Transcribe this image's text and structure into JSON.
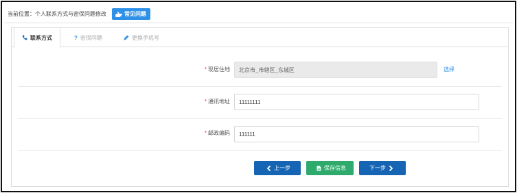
{
  "breadcrumb": {
    "text": "当前位置：个人联系方式与密保问题修改",
    "faq_button": "常见问题"
  },
  "tabs": [
    {
      "label": "联系方式",
      "icon": "phone-icon",
      "active": true
    },
    {
      "label": "密保问题",
      "icon": "question-icon",
      "active": false
    },
    {
      "label": "更换手机号",
      "icon": "pencil-icon",
      "active": false
    }
  ],
  "form": {
    "residence": {
      "label": "现居住地",
      "value": "北京市_市辖区_东城区",
      "select_label": "选择"
    },
    "mailing_address": {
      "label": "通讯地址",
      "value": "11111111"
    },
    "postal_code": {
      "label": "邮政编码",
      "value": "111111"
    }
  },
  "actions": {
    "prev": "上一步",
    "save": "保存信息",
    "next": "下一步"
  },
  "colors": {
    "primary": "#1565b4",
    "accent": "#2e90e6",
    "success": "#2eab6c",
    "required": "#e2383a"
  }
}
